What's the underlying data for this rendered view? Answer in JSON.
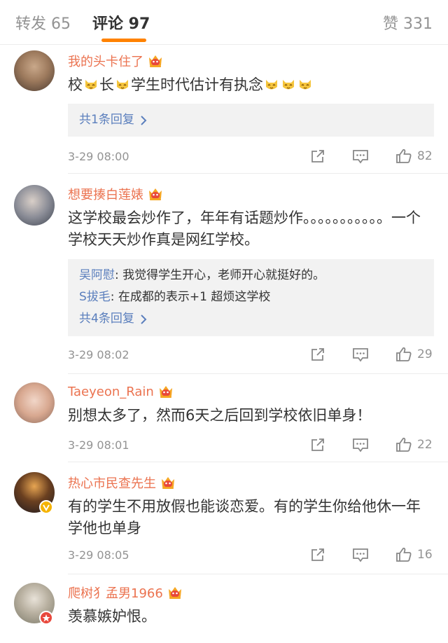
{
  "tabs": {
    "repost": "转发 65",
    "comments": "评论 97",
    "likes": "赞 331"
  },
  "colors": {
    "accent": "#ff8200",
    "username": "#eb7350",
    "link": "#5b7fbd",
    "muted": "#939393"
  },
  "comments": [
    {
      "username": "我的头卡住了",
      "text_parts": [
        "校",
        "长",
        "学生时代估计有执念"
      ],
      "replies": [],
      "reply_more": "共1条回复",
      "time": "3-29 08:00",
      "likes": "82"
    },
    {
      "username": "想要揍白莲婊",
      "text": "这学校最会炒作了，年年有话题炒作。。。。。。。。。。。一个学校天天炒作真是网红学校。",
      "replies": [
        {
          "user": "吴阿慰",
          "text": ": 我觉得学生开心，老师开心就挺好的。"
        },
        {
          "user": "S拔毛",
          "text": ": 在成都的表示+1 超烦这学校"
        }
      ],
      "reply_more": "共4条回复",
      "time": "3-29 08:02",
      "likes": "29"
    },
    {
      "username": "Taeyeon_Rain",
      "text": "别想太多了，然而6天之后回到学校依旧单身！",
      "time": "3-29 08:01",
      "likes": "22"
    },
    {
      "username": "热心市民查先生",
      "text": "有的学生不用放假也能谈恋爱。有的学生你给他休一年学他也单身",
      "time": "3-29 08:05",
      "likes": "16"
    },
    {
      "username": "爬树犭孟男1966",
      "text": "羡慕嫉妒恨。"
    }
  ],
  "icons": [
    "crown-badge-icon",
    "cat-emoji-icon",
    "share-icon",
    "comment-icon",
    "like-icon",
    "chevron-right-icon",
    "verified-icon"
  ]
}
